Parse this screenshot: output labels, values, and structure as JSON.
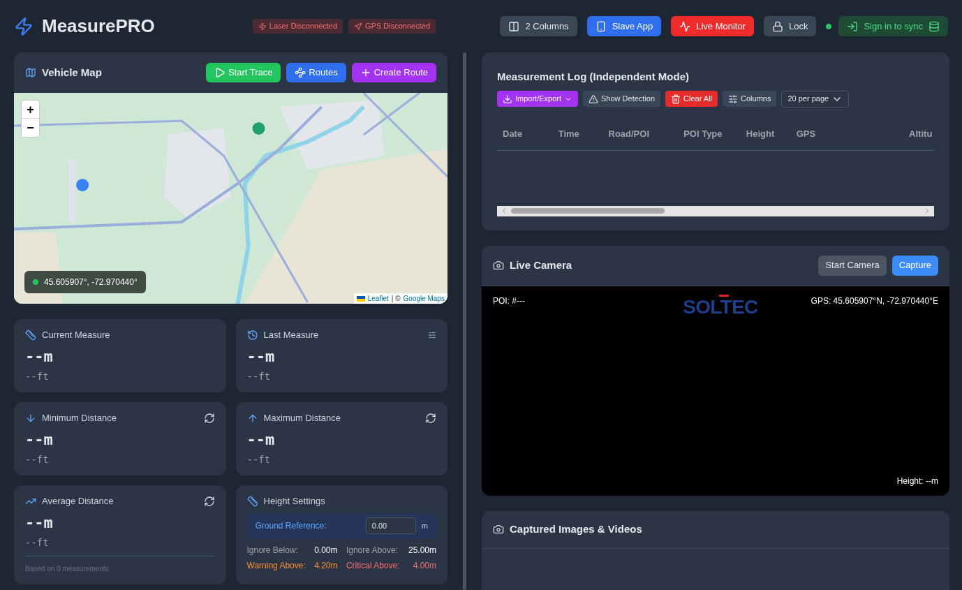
{
  "header": {
    "title": "MeasurePRO",
    "status_badges": [
      {
        "label": "Laser Disconnected",
        "kind": "laser"
      },
      {
        "label": "GPS Disconnected",
        "kind": "gps"
      }
    ],
    "buttons": [
      {
        "label": "2 Columns",
        "kind": "columns"
      },
      {
        "label": "Slave App",
        "kind": "slave"
      },
      {
        "label": "Live Monitor",
        "kind": "monitor"
      },
      {
        "label": "Lock",
        "kind": "lock"
      },
      {
        "label": "Sign in to sync",
        "kind": "sync"
      }
    ]
  },
  "vehicle_map": {
    "title": "Vehicle Map",
    "buttons": [
      {
        "label": "Start Trace",
        "kind": "trace"
      },
      {
        "label": "Routes",
        "kind": "routes"
      },
      {
        "label": "Create Route",
        "kind": "create"
      }
    ],
    "zoom_controls": [
      "+",
      "−"
    ],
    "coordinates": "45.605907°, -72.970440°",
    "attribution": {
      "library": "Leaflet",
      "separator": "| ©",
      "source": "Google Maps"
    }
  },
  "cards": [
    {
      "kind": "measure",
      "title": "Current Measure",
      "value": "--m",
      "sub": "--ft"
    },
    {
      "kind": "measure",
      "title": "Last Measure",
      "value": "--m",
      "sub": "--ft"
    },
    {
      "kind": "measure",
      "title": "Minimum Distance",
      "value": "--m",
      "sub": "--ft"
    },
    {
      "kind": "measure",
      "title": "Maximum Distance",
      "value": "--m",
      "sub": "--ft"
    },
    {
      "kind": "measure",
      "title": "Average Distance",
      "value": "--m",
      "sub": "--ft",
      "footer": "Based on 0 measurements"
    },
    {
      "kind": "settings",
      "title": "Height Settings",
      "ground_reference": {
        "label": "Ground Reference:",
        "value": "0.00",
        "unit": "m"
      },
      "thresholds": [
        {
          "label": "Ignore Below:",
          "value": "0.00m",
          "kind": "normal"
        },
        {
          "label": "Ignore Above:",
          "value": "25.00m",
          "kind": "normal"
        },
        {
          "label": "Warning Above:",
          "value": "4.20m",
          "kind": "warning"
        },
        {
          "label": "Critical Above:",
          "value": "4.00m",
          "kind": "critical"
        }
      ]
    }
  ],
  "measurement_log": {
    "title": "Measurement Log (Independent Mode)",
    "toolbar": [
      {
        "label": "Import/Export",
        "kind": "import"
      },
      {
        "label": "Show Detection",
        "kind": "detection"
      },
      {
        "label": "Clear All",
        "kind": "clear"
      },
      {
        "label": "Columns",
        "kind": "columns"
      }
    ],
    "per_page": "20 per page",
    "columns": [
      "Date",
      "Time",
      "Road/POI",
      "POI Type",
      "Height",
      "GPS",
      "Altitu"
    ]
  },
  "live_camera": {
    "title": "Live Camera",
    "buttons": [
      {
        "label": "Start Camera",
        "kind": "secondary"
      },
      {
        "label": "Capture",
        "kind": "primary"
      }
    ],
    "poi": "POI: #---",
    "logo": "SOLTEC",
    "gps": "GPS: 45.605907°N, -72.970440°E",
    "height": "Height: --m"
  },
  "captured": {
    "title": "Captured Images & Videos"
  }
}
